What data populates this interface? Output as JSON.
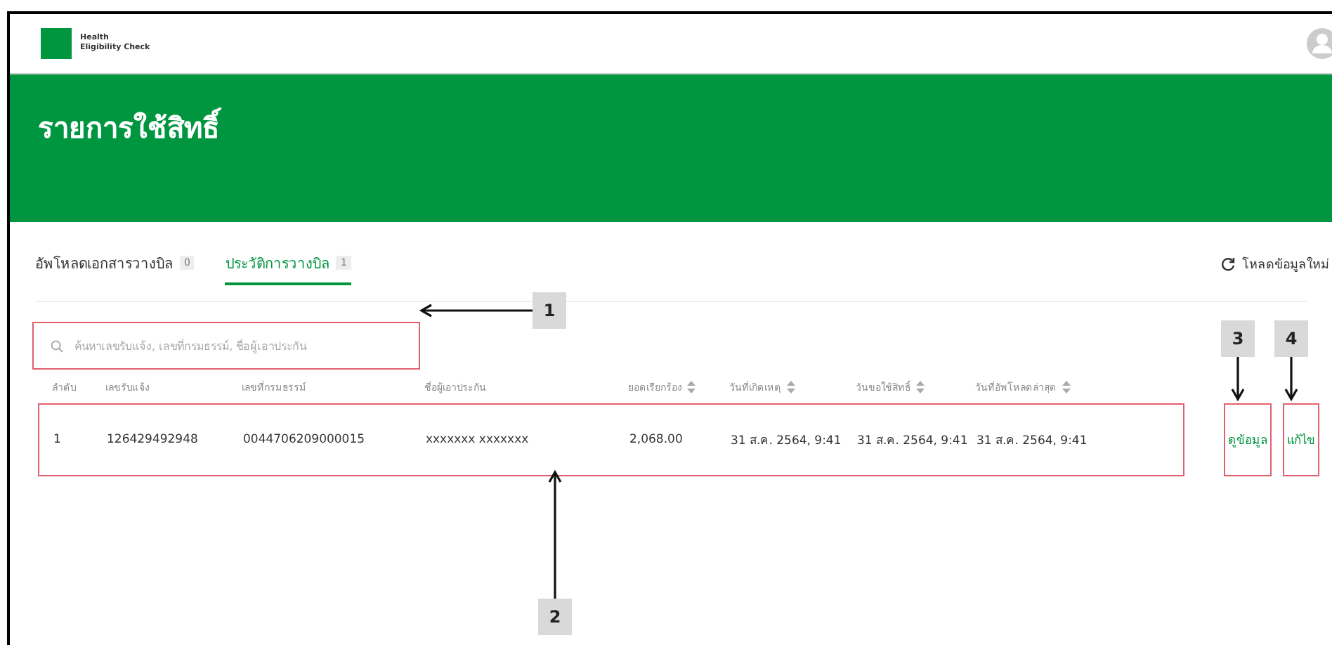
{
  "app": {
    "logo_line_1": "Health",
    "logo_line_2": "Eligibility Check"
  },
  "page_title": "รายการใช้สิทธิ์",
  "tabs": [
    {
      "label": "อัพโหลดเอกสารวางบิล",
      "count": "0",
      "selected": false
    },
    {
      "label": "ประวัติการวางบิล",
      "count": "1",
      "selected": true
    }
  ],
  "refresh_button": {
    "label": "โหลดข้อมูลใหม่"
  },
  "search": {
    "placeholder": "ค้นหาเลขรับแจ้ง, เลขที่กรมธรรม์, ชื่อผู้เอาประกัน",
    "highlighted": true
  },
  "table": {
    "columns": [
      {
        "label": "ลำดับ",
        "sortable": false
      },
      {
        "label": "เลขรับแจ้ง",
        "sortable": false
      },
      {
        "label": "เลขที่กรมธรรม์",
        "sortable": false
      },
      {
        "label": "ชื่อผู้เอาประกัน",
        "sortable": false
      },
      {
        "label": "ยอดเรียกร้อง",
        "sortable": true
      },
      {
        "label": "วันที่เกิดเหตุ",
        "sortable": true
      },
      {
        "label": "วันขอใช้สิทธิ์",
        "sortable": true
      },
      {
        "label": "วันที่อัพโหลดล่าสุด",
        "sortable": true
      }
    ],
    "rows": [
      {
        "cells": [
          "1",
          "126429492948",
          "0044706209000015",
          "xxxxxxx xxxxxxx",
          "2,068.00",
          "31 ส.ค. 2564, 9:41",
          "31 ส.ค. 2564, 9:41",
          "31 ส.ค. 2564, 9:41"
        ],
        "highlighted": true,
        "actions": [
          {
            "label": "ดูข้อมูล",
            "highlighted": true
          },
          {
            "label": "แก้ไข",
            "highlighted": true
          }
        ]
      }
    ]
  },
  "callouts": [
    {
      "label": "1"
    },
    {
      "label": "2"
    },
    {
      "label": "3"
    },
    {
      "label": "4"
    }
  ]
}
